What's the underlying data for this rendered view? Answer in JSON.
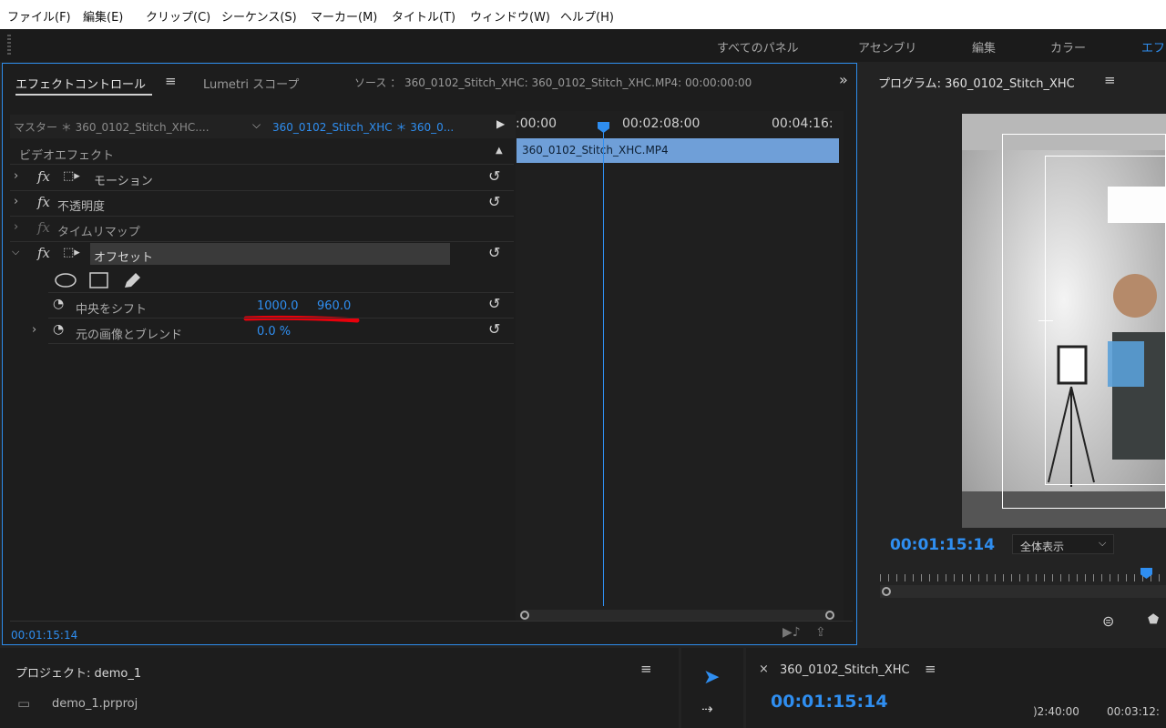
{
  "menubar": {
    "items": [
      "ファイル(F)",
      "編集(E)",
      "クリップ(C)",
      "シーケンス(S)",
      "マーカー(M)",
      "タイトル(T)",
      "ウィンドウ(W)",
      "ヘルプ(H)"
    ]
  },
  "workspace": {
    "tabs": [
      "すべてのパネル",
      "アセンブリ",
      "編集",
      "カラー",
      "エフ"
    ]
  },
  "effect_panel": {
    "tab_effect_controls": "エフェクトコントロール",
    "tab_lumetri": "Lumetri スコープ",
    "source_info": "ソース ： 360_0102_Stitch_XHC: 360_0102_Stitch_XHC.MP4: 00:00:00:00",
    "master_label": "マスター ＊ 360_0102_Stitch_XHC....",
    "clip_label": "360_0102_Stitch_XHC ＊ 360_0...",
    "section_video_effects": "ビデオエフェクト",
    "effects": [
      {
        "name": "モーション"
      },
      {
        "name": "不透明度"
      },
      {
        "name": "タイムリマップ"
      },
      {
        "name": "オフセット"
      }
    ],
    "params": {
      "shift_center_label": "中央をシフト",
      "shift_center_x": "1000.0",
      "shift_center_y": "960.0",
      "blend_label": "元の画像とブレンド",
      "blend_value": "0.0 %"
    },
    "timeline": {
      "ruler_labels": [
        ":00:00",
        "00:02:08:00",
        "00:04:16:"
      ],
      "clip_name": "360_0102_Stitch_XHC.MP4"
    },
    "current_time": "00:01:15:14"
  },
  "program": {
    "title": "プログラム: 360_0102_Stitch_XHC",
    "timecode": "00:01:15:14",
    "fit_label": "全体表示"
  },
  "project": {
    "title": "プロジェクト: demo_1",
    "file": "demo_1.prproj"
  },
  "sequence": {
    "title": "360_0102_Stitch_XHC",
    "timecode": "00:01:15:14",
    "ruler": [
      ")2:40:00",
      "00:03:12:"
    ]
  },
  "colors": {
    "accent": "#2f8ef0",
    "clip": "#6f9fd8",
    "annotation": "#e8000b"
  }
}
